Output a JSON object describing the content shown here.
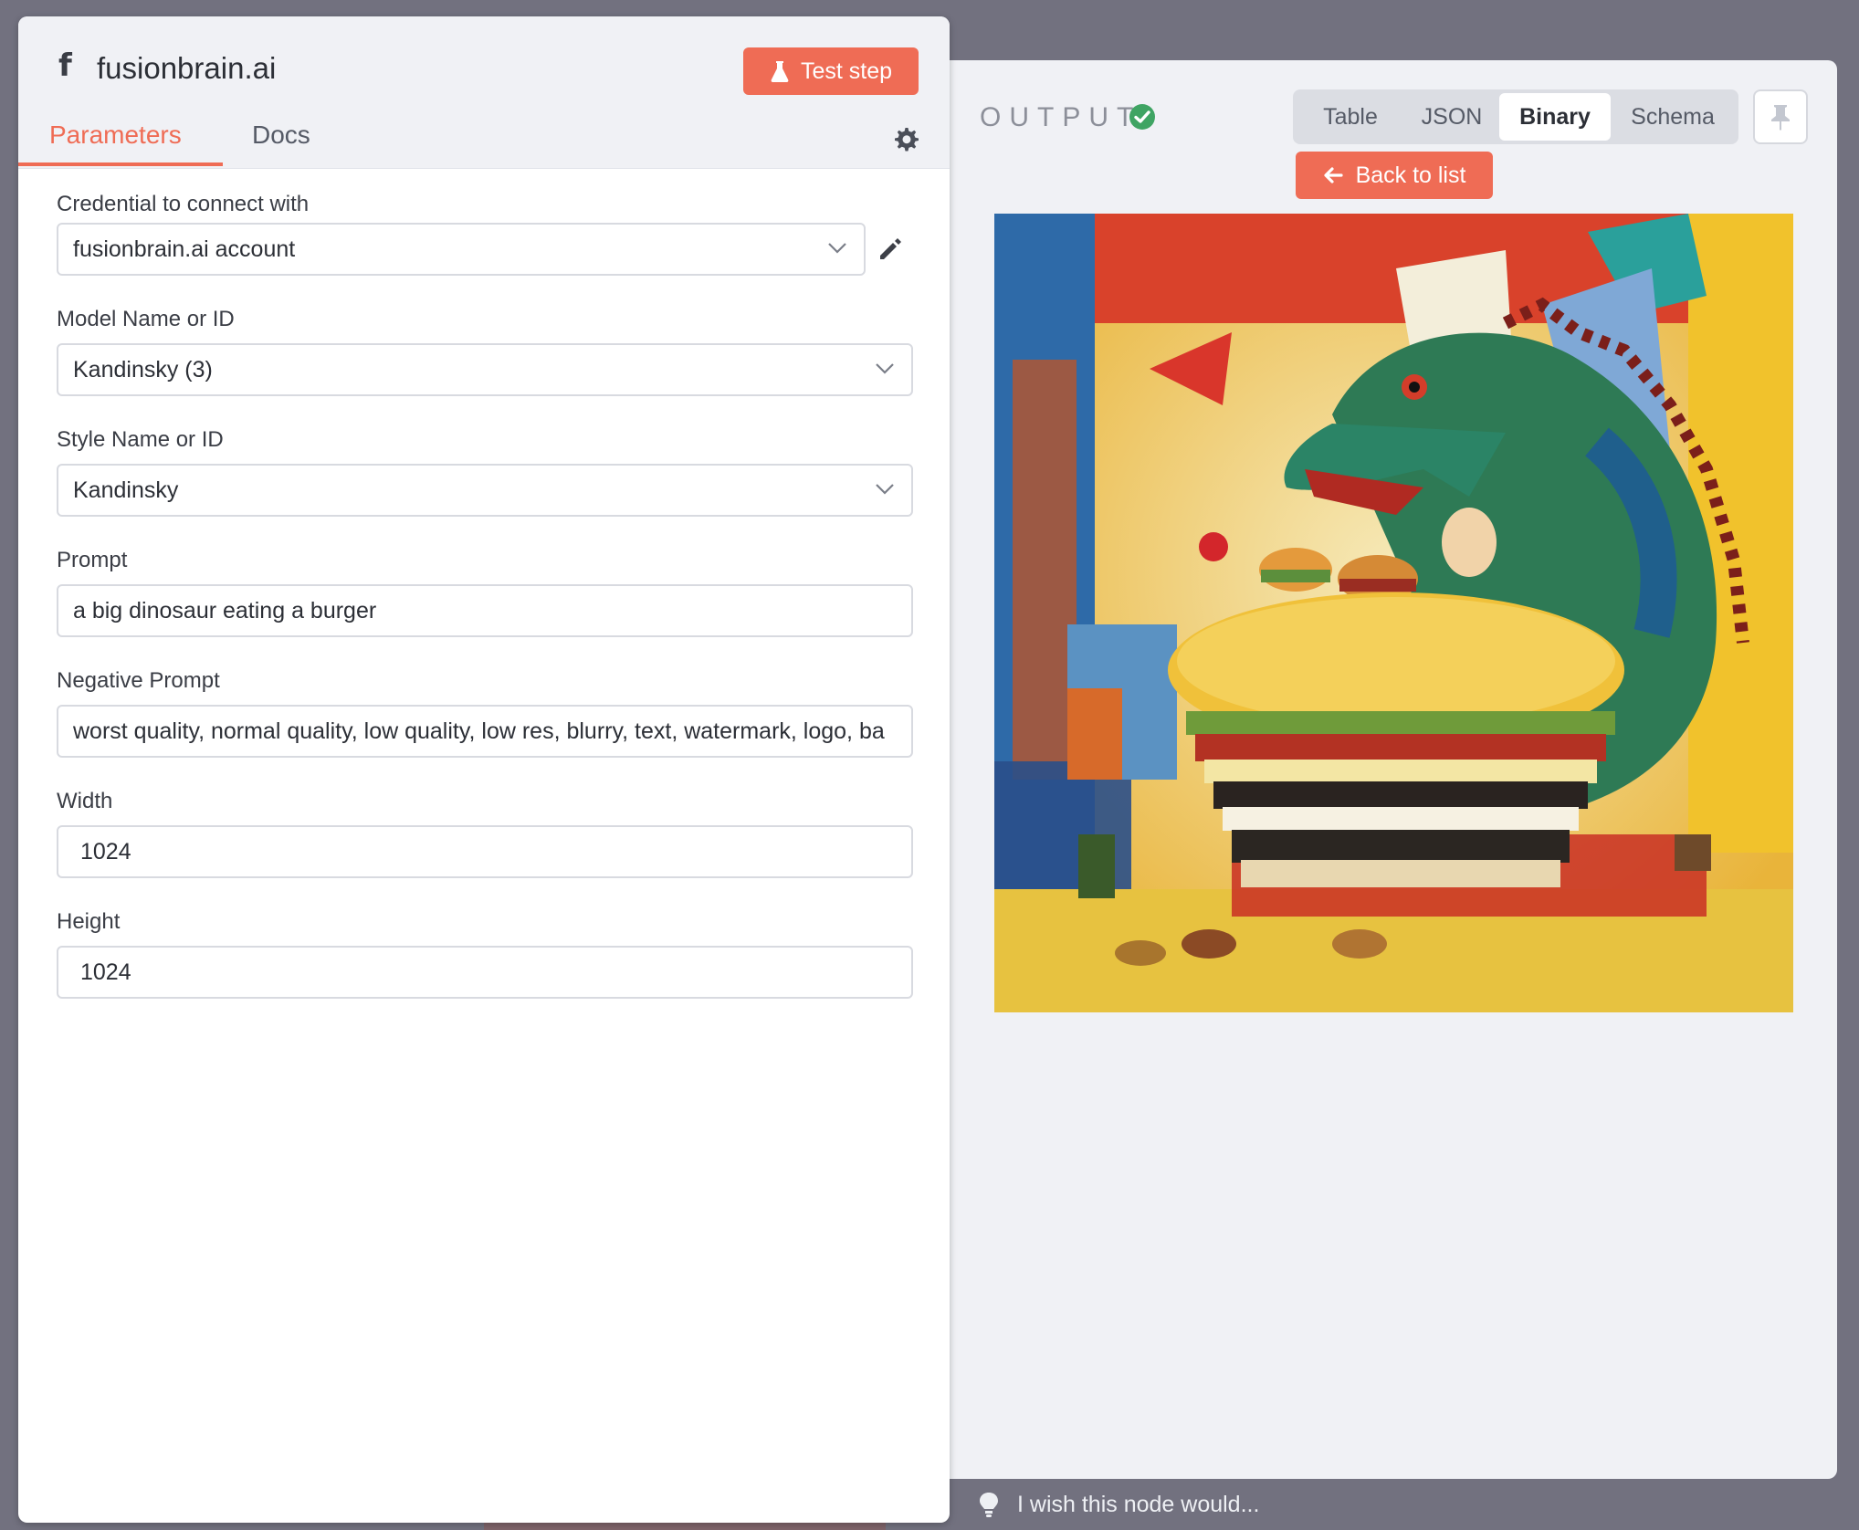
{
  "node": {
    "icon_letter": "f",
    "title": "fusionbrain.ai",
    "test_step_label": "Test step"
  },
  "tabs": [
    {
      "label": "Parameters",
      "active": true
    },
    {
      "label": "Docs",
      "active": false
    }
  ],
  "fields": {
    "credential": {
      "label": "Credential to connect with",
      "value": "fusionbrain.ai account"
    },
    "model": {
      "label": "Model Name or ID",
      "value": "Kandinsky (3)"
    },
    "style": {
      "label": "Style Name or ID",
      "value": "Kandinsky"
    },
    "prompt": {
      "label": "Prompt",
      "value": "a big dinosaur eating a burger"
    },
    "negative_prompt": {
      "label": "Negative Prompt",
      "value": "worst quality, normal quality, low quality, low res, blurry, text, watermark, logo, ba"
    },
    "width": {
      "label": "Width",
      "value": "1024"
    },
    "height": {
      "label": "Height",
      "value": "1024"
    }
  },
  "output": {
    "label": "OUTPUT",
    "status": "success",
    "view_tabs": [
      "Table",
      "JSON",
      "Binary",
      "Schema"
    ],
    "active_view": "Binary",
    "back_label": "Back to list"
  },
  "feedback": {
    "placeholder": "I wish this node would..."
  },
  "colors": {
    "accent": "#ef6c55",
    "success": "#3fa463",
    "panel_bg": "#f0f1f5",
    "backdrop": "#72717f"
  }
}
